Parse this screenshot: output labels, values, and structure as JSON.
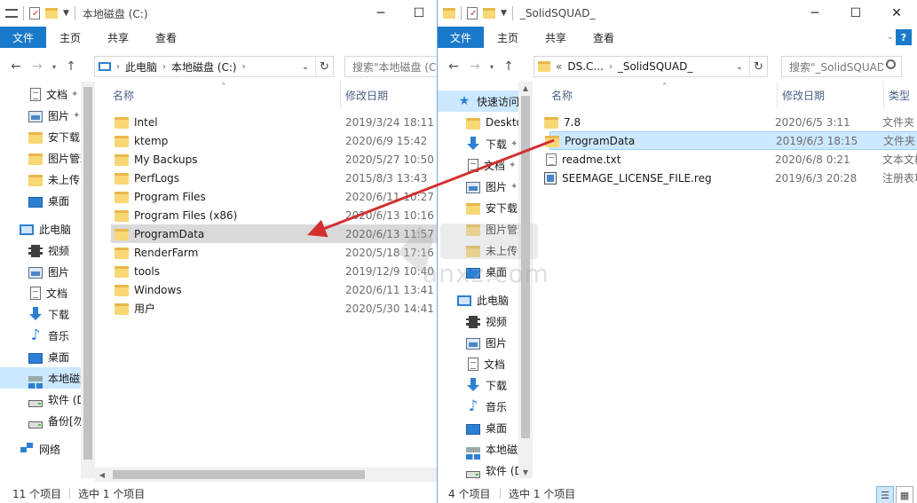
{
  "left": {
    "title": "本地磁盘 (C:)",
    "ribbon_tabs": [
      "文件",
      "主页",
      "共享",
      "查看"
    ],
    "path": [
      "此电脑",
      "本地磁盘 (C:)"
    ],
    "search_placeholder": "搜索\"本地磁盘 (C:)\"",
    "nav": [
      {
        "label": "文档",
        "icon": "document-icon",
        "pinned": true
      },
      {
        "label": "图片",
        "icon": "pictures-icon",
        "pinned": true
      },
      {
        "label": "安下载",
        "icon": "folder-icon"
      },
      {
        "label": "图片管理",
        "icon": "folder-icon"
      },
      {
        "label": "未上传",
        "icon": "folder-icon"
      },
      {
        "label": "桌面",
        "icon": "desktop-icon"
      },
      {
        "label": "此电脑",
        "icon": "computer-icon"
      },
      {
        "label": "视频",
        "icon": "video-icon"
      },
      {
        "label": "图片",
        "icon": "pictures-icon"
      },
      {
        "label": "文档",
        "icon": "document-icon"
      },
      {
        "label": "下载",
        "icon": "download-icon"
      },
      {
        "label": "音乐",
        "icon": "music-icon"
      },
      {
        "label": "桌面",
        "icon": "desktop-icon"
      },
      {
        "label": "本地磁盘 (C:)",
        "icon": "windows-drive-icon",
        "selected": true
      },
      {
        "label": "软件 (D:)",
        "icon": "drive-icon"
      },
      {
        "label": "备份[勿删] (E:)",
        "icon": "drive-icon"
      },
      {
        "label": "网络",
        "icon": "network-icon"
      }
    ],
    "columns": {
      "name": "名称",
      "date": "修改日期"
    },
    "files": [
      {
        "name": "Intel",
        "date": "2019/3/24 18:11"
      },
      {
        "name": "ktemp",
        "date": "2020/6/9 15:42"
      },
      {
        "name": "My Backups",
        "date": "2020/5/27 10:50"
      },
      {
        "name": "PerfLogs",
        "date": "2015/8/3 13:43"
      },
      {
        "name": "Program Files",
        "date": "2020/6/11 10:27"
      },
      {
        "name": "Program Files (x86)",
        "date": "2020/6/13 10:16"
      },
      {
        "name": "ProgramData",
        "date": "2020/6/13 11:57",
        "selected": true
      },
      {
        "name": "RenderFarm",
        "date": "2020/5/18 17:16"
      },
      {
        "name": "tools",
        "date": "2019/12/9 10:40"
      },
      {
        "name": "Windows",
        "date": "2020/6/11 13:41"
      },
      {
        "name": "用户",
        "date": "2020/5/30 14:41"
      }
    ],
    "status_count": "11 个项目",
    "status_selected": "选中 1 个项目"
  },
  "right": {
    "title": "_SolidSQUAD_",
    "ribbon_tabs": [
      "文件",
      "主页",
      "共享",
      "查看"
    ],
    "path_overflow": "«",
    "path": [
      "DS.C...",
      "_SolidSQUAD_"
    ],
    "search_placeholder": "搜索\"_SolidSQUAD_\"",
    "nav": [
      {
        "label": "快速访问",
        "icon": "star-icon",
        "selected": true
      },
      {
        "label": "Desktop",
        "icon": "folder-icon",
        "pinned": true
      },
      {
        "label": "下载",
        "icon": "download-icon",
        "pinned": true
      },
      {
        "label": "文档",
        "icon": "document-icon",
        "pinned": true
      },
      {
        "label": "图片",
        "icon": "pictures-icon",
        "pinned": true
      },
      {
        "label": "安下载",
        "icon": "folder-icon"
      },
      {
        "label": "图片管理",
        "icon": "folder-icon"
      },
      {
        "label": "未上传",
        "icon": "folder-icon"
      },
      {
        "label": "桌面",
        "icon": "desktop-icon"
      },
      {
        "label": "此电脑",
        "icon": "computer-icon"
      },
      {
        "label": "视频",
        "icon": "video-icon"
      },
      {
        "label": "图片",
        "icon": "pictures-icon"
      },
      {
        "label": "文档",
        "icon": "document-icon"
      },
      {
        "label": "下载",
        "icon": "download-icon"
      },
      {
        "label": "音乐",
        "icon": "music-icon"
      },
      {
        "label": "桌面",
        "icon": "desktop-icon"
      },
      {
        "label": "本地磁盘 (C:)",
        "icon": "windows-drive-icon"
      },
      {
        "label": "软件 (D:)",
        "icon": "drive-icon"
      }
    ],
    "columns": {
      "name": "名称",
      "date": "修改日期",
      "type": "类型"
    },
    "files": [
      {
        "name": "7.8",
        "date": "2020/6/5 3:11",
        "type": "文件夹",
        "icon": "folder-icon"
      },
      {
        "name": "ProgramData",
        "date": "2019/6/3 18:15",
        "type": "文件夹",
        "icon": "folder-icon",
        "selected": true
      },
      {
        "name": "readme.txt",
        "date": "2020/6/8 0:21",
        "type": "文本文档",
        "icon": "text-file-icon"
      },
      {
        "name": "SEEMAGE_LICENSE_FILE.reg",
        "date": "2019/6/3 20:28",
        "type": "注册表项",
        "icon": "registry-file-icon"
      }
    ],
    "status_count": "4 个项目",
    "status_selected": "选中 1 个项目"
  },
  "watermark": {
    "text": "anxz.com"
  },
  "colors": {
    "accent": "#1979ca",
    "arrow": "#d32f2f",
    "selection": "#cce8ff"
  }
}
